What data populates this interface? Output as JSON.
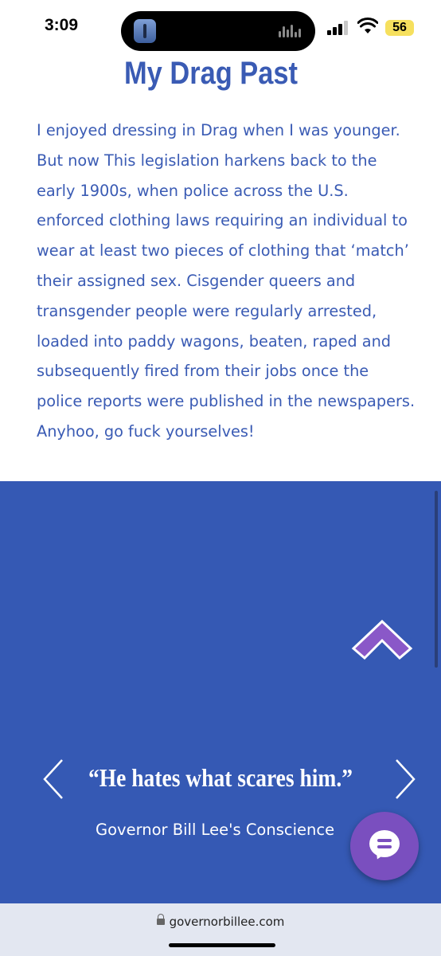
{
  "status_bar": {
    "time": "3:09",
    "battery": "56"
  },
  "article": {
    "title": "My Drag Past",
    "body": "I enjoyed dressing in Drag when I was younger. But now This legislation harkens back to the early 1900s, when police across the U.S. enforced clothing laws requiring an individual to wear at least two pieces of clothing that ‘match’ their assigned sex. Cisgender queers and transgender people were regularly arrested, loaded into paddy wagons, beaten, raped and subsequently fired from their jobs once the police reports were published in the newspapers. Anyhoo, go fuck yourselves!"
  },
  "testimonial": {
    "quote": "“He hates what scares him.”",
    "attribution": "Governor Bill Lee's Conscience"
  },
  "browser": {
    "url": "governorbillee.com"
  },
  "colors": {
    "text_blue": "#3a5bb4",
    "section_blue": "#3559b4",
    "chat_purple": "#7a4fbf",
    "up_arrow_purple": "#8a58c8"
  },
  "icons": {
    "scroll_up": "chevron-up-icon",
    "prev": "chevron-left-icon",
    "next": "chevron-right-icon",
    "chat": "chat-bubble-icon",
    "lock": "lock-icon"
  }
}
